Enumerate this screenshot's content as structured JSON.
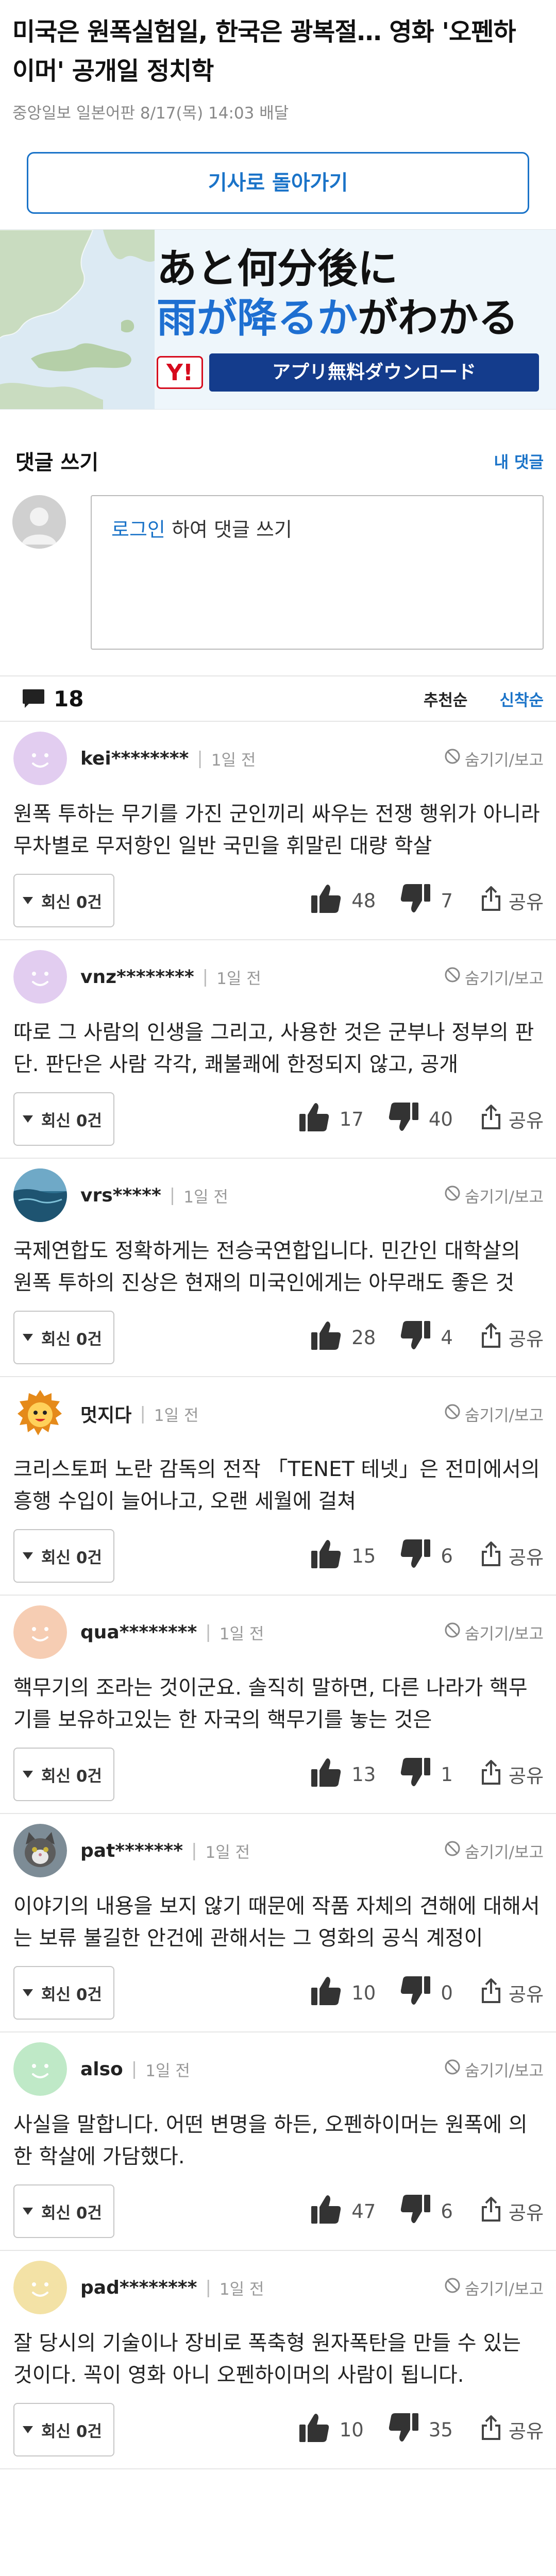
{
  "article": {
    "title": "미국은 원폭실험일, 한국은 광복절… 영화 '오펜하이머' 공개일 정치학",
    "meta": "중앙일보 일본어판 8/17(목) 14:03 배달"
  },
  "back_button": "기사로 돌아가기",
  "ad": {
    "line1": "あと何分後に",
    "line2_blue": "雨が降るか",
    "line2_rest": "がわかる",
    "logo": "Y!",
    "cta": "アプリ無料ダウンロード"
  },
  "comment_write": {
    "title": "댓글 쓰기",
    "my_comments": "내 댓글",
    "login_link": "로그인",
    "prompt": " 하여 댓글 쓰기"
  },
  "list_header": {
    "count": "18",
    "sort_recommended": "추천순",
    "sort_newest": "신착순"
  },
  "labels": {
    "hide": "숨기기/보고",
    "reply": "회신 0건",
    "share": "공유",
    "separator": "|"
  },
  "comments": [
    {
      "user": "kei********",
      "time": "1일 전",
      "text": "원폭 투하는 무기를 가진 군인끼리 싸우는 전쟁 행위가 아니라 무차별로 무저항인 일반 국민을 휘말린 대량 학살",
      "likes": "48",
      "dislikes": "7",
      "avatar": "lavender-circle"
    },
    {
      "user": "vnz********",
      "time": "1일 전",
      "text": "따로 그 사람의 인생을 그리고, 사용한 것은 군부나 정부의 판단. 판단은 사람 각각, 쾌불쾌에 한정되지 않고, 공개",
      "likes": "17",
      "dislikes": "40",
      "avatar": "lavender-circle"
    },
    {
      "user": "vrs*****",
      "time": "1일 전",
      "text": "국제연합도 정확하게는 전승국연합입니다. 민간인 대학살의 원폭 투하의 진상은 현재의 미국인에게는 아무래도 좋은 것",
      "likes": "28",
      "dislikes": "4",
      "avatar": "ocean-photo"
    },
    {
      "user": "멋지다",
      "time": "1일 전",
      "text": "크리스토퍼 노란 감독의 전작 「TENET 테넷」은 전미에서의 흥행 수입이 늘어나고, 오랜 세월에 걸쳐",
      "likes": "15",
      "dislikes": "6",
      "avatar": "lion-mascot"
    },
    {
      "user": "qua********",
      "time": "1일 전",
      "text": "핵무기의 조라는 것이군요. 솔직히 말하면, 다른 나라가 핵무기를 보유하고있는 한 자국의 핵무기를 놓는 것은",
      "likes": "13",
      "dislikes": "1",
      "avatar": "peach-circle"
    },
    {
      "user": "pat*******",
      "time": "1일 전",
      "text": "이야기의 내용을 보지 않기 때문에 작품 자체의 견해에 대해서는 보류 불길한 안건에 관해서는 그 영화의 공식 계정이",
      "likes": "10",
      "dislikes": "0",
      "avatar": "cat-photo"
    },
    {
      "user": "also",
      "time": "1일 전",
      "text": "사실을 말합니다. 어떤 변명을 하든, 오펜하이머는 원폭에 의한 학살에 가담했다.",
      "likes": "47",
      "dislikes": "6",
      "avatar": "mint-circle"
    },
    {
      "user": "pad********",
      "time": "1일 전",
      "text": "잘 당시의 기술이나 장비로 폭축형 원자폭탄을 만들 수 있는 것이다. 꼭이 영화 아니 오펜하이머의 사람이 됩니다.",
      "likes": "10",
      "dislikes": "35",
      "avatar": "yellow-circle"
    }
  ],
  "colors": {
    "accent": "#1a73c8",
    "ad_cta": "#143c8c",
    "ad_logo": "#d60b1d"
  }
}
